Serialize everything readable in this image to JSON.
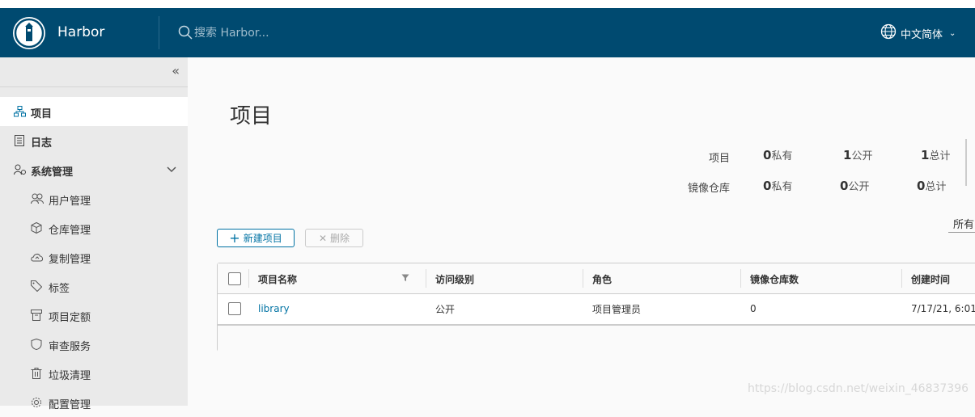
{
  "header": {
    "brand": "Harbor",
    "search_placeholder": "搜索 Harbor...",
    "language": "中文简体"
  },
  "sidebar": {
    "items": [
      {
        "label": "项目",
        "icon": "projects-icon"
      },
      {
        "label": "日志",
        "icon": "logs-icon"
      },
      {
        "label": "系统管理",
        "icon": "admin-icon"
      }
    ],
    "sub_items": [
      {
        "label": "用户管理",
        "icon": "users-icon"
      },
      {
        "label": "仓库管理",
        "icon": "registry-icon"
      },
      {
        "label": "复制管理",
        "icon": "replication-icon"
      },
      {
        "label": "标签",
        "icon": "tag-icon"
      },
      {
        "label": "项目定额",
        "icon": "quota-icon"
      },
      {
        "label": "审查服务",
        "icon": "shield-icon"
      },
      {
        "label": "垃圾清理",
        "icon": "trash-icon"
      },
      {
        "label": "配置管理",
        "icon": "gear-icon"
      }
    ]
  },
  "main": {
    "title": "项目",
    "stats": {
      "rows": [
        {
          "label": "项目",
          "private_count": "0",
          "private_label": "私有",
          "public_count": "1",
          "public_label": "公开",
          "total_count": "1",
          "total_label": "总计"
        },
        {
          "label": "镜像仓库",
          "private_count": "0",
          "private_label": "私有",
          "public_count": "0",
          "public_label": "公开",
          "total_count": "0",
          "total_label": "总计"
        }
      ]
    },
    "filter_label": "所有",
    "buttons": {
      "new_project": "新建项目",
      "delete": "删除"
    },
    "table": {
      "columns": [
        "项目名称",
        "访问级别",
        "角色",
        "镜像仓库数",
        "创建时间"
      ],
      "rows": [
        {
          "name": "library",
          "access": "公开",
          "role": "项目管理员",
          "repo_count": "0",
          "created": "7/17/21, 6:01"
        }
      ]
    }
  },
  "watermark": "https://blog.csdn.net/weixin_46837396"
}
